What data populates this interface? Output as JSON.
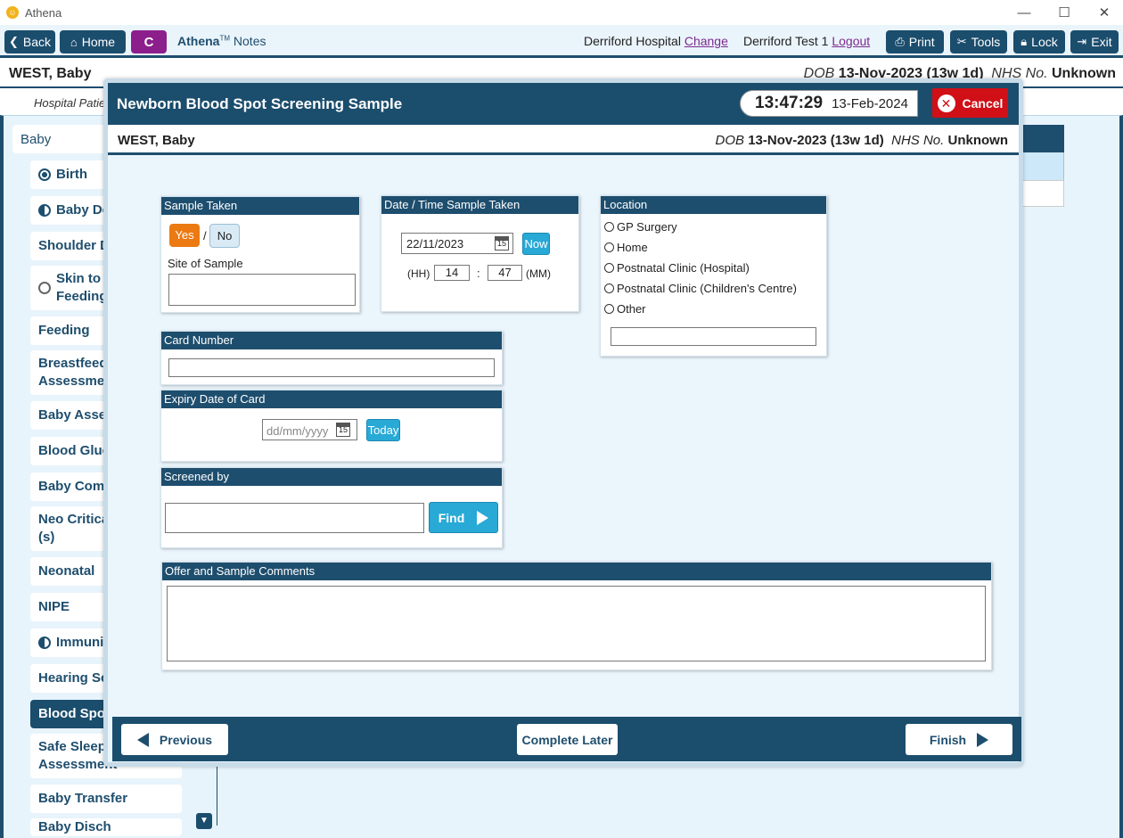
{
  "window": {
    "title": "Athena",
    "logo": "athena-logo-icon"
  },
  "toolbar": {
    "back": "Back",
    "home": "Home",
    "c_label": "C",
    "app_name": "Athena",
    "app_tm": "TM",
    "app_notes": "Notes",
    "hospital": "Derriford Hospital",
    "change": "Change",
    "user": "Derriford Test 1",
    "logout": "Logout",
    "print": "Print",
    "tools": "Tools",
    "lock": "Lock",
    "exit": "Exit"
  },
  "patient": {
    "name": "WEST, Baby",
    "dob_label": "DOB",
    "dob": "13-Nov-2023 (13w 1d)",
    "nhs_label": "NHS No.",
    "nhs": "Unknown"
  },
  "subbar": {
    "text": "Hospital Patie"
  },
  "sidebar": {
    "heading": "Baby",
    "items": [
      {
        "label": "Birth",
        "icon": "full"
      },
      {
        "label": "Baby De",
        "icon": "half"
      },
      {
        "label": "Shoulder D",
        "icon": ""
      },
      {
        "label": "Skin to S",
        "label2": "Feeding",
        "icon": "empty"
      },
      {
        "label": "Feeding",
        "icon": ""
      },
      {
        "label": "Breastfeedi",
        "label2": "Assessmen",
        "icon": ""
      },
      {
        "label": "Baby Asses",
        "icon": ""
      },
      {
        "label": "Blood Gluc",
        "icon": ""
      },
      {
        "label": "Baby Comm",
        "icon": ""
      },
      {
        "label": "Neo Critica",
        "label2": "(s)",
        "icon": ""
      },
      {
        "label": "Neonatal",
        "icon": ""
      },
      {
        "label": "NIPE",
        "icon": ""
      },
      {
        "label": "Immunis",
        "icon": "half"
      },
      {
        "label": "Hearing Sc",
        "icon": ""
      },
      {
        "label": "Blood Spot",
        "icon": "",
        "active": true
      },
      {
        "label": "Safe Sleepi",
        "label2": "Assessment",
        "icon": ""
      },
      {
        "label": "Baby Transfer",
        "icon": ""
      },
      {
        "label": "Baby Disch",
        "icon": ""
      }
    ]
  },
  "modal": {
    "title": "Newborn Blood Spot Screening Sample",
    "time": "13:47:29",
    "date": "13-Feb-2024",
    "cancel": "Cancel",
    "sample_taken": {
      "title": "Sample Taken",
      "yes": "Yes",
      "slash": "/",
      "no": "No",
      "site_label": "Site of Sample",
      "site_value": ""
    },
    "datetime": {
      "title": "Date / Time Sample Taken",
      "date_value": "22/11/2023",
      "now": "Now",
      "hh_label": "(HH)",
      "hh": "14",
      "colon": ":",
      "mm": "47",
      "mm_label": "(MM)",
      "cal_day": "15"
    },
    "location": {
      "title": "Location",
      "options": [
        "GP Surgery",
        "Home",
        "Postnatal Clinic (Hospital)",
        "Postnatal Clinic (Children's Centre)",
        "Other"
      ],
      "other_value": ""
    },
    "card_number": {
      "title": "Card Number",
      "value": ""
    },
    "expiry": {
      "title": "Expiry Date of Card",
      "placeholder": "dd/mm/yyyy",
      "today": "Today",
      "cal_day": "15"
    },
    "screened_by": {
      "title": "Screened by",
      "value": "",
      "find": "Find"
    },
    "comments": {
      "title": "Offer and Sample Comments",
      "value": ""
    },
    "footer": {
      "previous": "Previous",
      "complete_later": "Complete Later",
      "finish": "Finish"
    }
  },
  "colors": {
    "primary": "#1b4d6d",
    "accent_orange": "#ec7a12",
    "accent_blue": "#28a9d6",
    "cancel_red": "#d10f17",
    "purple": "#8c1f8c"
  }
}
